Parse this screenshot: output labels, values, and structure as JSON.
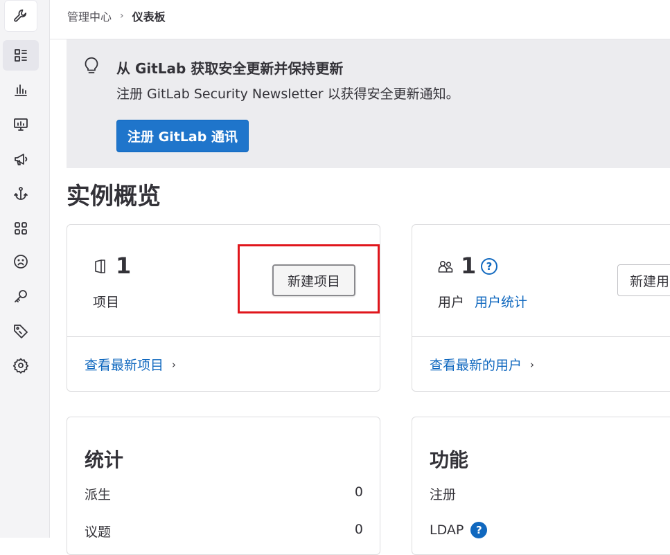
{
  "sidebar": {
    "items": [
      {
        "name": "wrench-icon"
      },
      {
        "name": "dashboard-icon"
      },
      {
        "name": "chart-icon"
      },
      {
        "name": "monitor-icon"
      },
      {
        "name": "megaphone-icon"
      },
      {
        "name": "anchor-icon"
      },
      {
        "name": "apps-icon"
      },
      {
        "name": "abuse-icon"
      },
      {
        "name": "key-icon"
      },
      {
        "name": "label-icon"
      },
      {
        "name": "settings-icon"
      }
    ]
  },
  "breadcrumb": {
    "parent": "管理中心",
    "current": "仪表板"
  },
  "banner": {
    "title": "从 GitLab 获取安全更新并保持更新",
    "text": "注册 GitLab Security Newsletter 以获得安全更新通知。",
    "button": "注册 GitLab 通讯"
  },
  "page_title": "实例概览",
  "projects_card": {
    "count": "1",
    "label": "项目",
    "button": "新建项目",
    "footer_link": "查看最新项目"
  },
  "users_card": {
    "count": "1",
    "label": "用户",
    "stats_link": "用户统计",
    "button": "新建用",
    "footer_link": "查看最新的用户"
  },
  "statistics": {
    "title": "统计",
    "rows": [
      {
        "label": "派生",
        "value": "0"
      },
      {
        "label": "议题",
        "value": "0"
      }
    ]
  },
  "features": {
    "title": "功能",
    "rows": [
      {
        "label": "注册"
      },
      {
        "label": "LDAP"
      }
    ]
  },
  "colors": {
    "accent": "#1f75cb",
    "link": "#1068bf",
    "highlight": "#e0161c"
  }
}
